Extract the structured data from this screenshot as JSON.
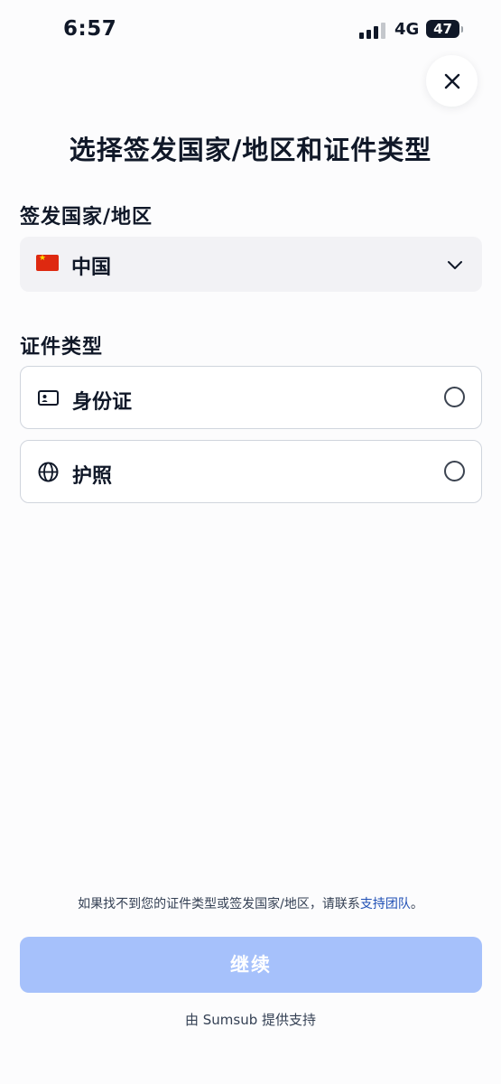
{
  "status_bar": {
    "time": "6:57",
    "network": "4G",
    "battery": "47"
  },
  "close_icon": "close-icon",
  "title": "选择签发国家/地区和证件类型",
  "country_section": {
    "label": "签发国家/地区",
    "selected_country": "中国",
    "flag_icon": "china-flag-icon",
    "dropdown_icon": "chevron-down-icon"
  },
  "doc_section": {
    "label": "证件类型",
    "options": [
      {
        "label": "身份证",
        "icon": "id-card-icon"
      },
      {
        "label": "护照",
        "icon": "globe-icon"
      }
    ]
  },
  "help": {
    "prefix": "如果找不到您的证件类型或签发国家/地区，请联系",
    "link": "支持团队",
    "suffix": "。"
  },
  "continue_label": "继续",
  "powered_by": "由 Sumsub 提供支持",
  "colors": {
    "accent_disabled": "#a6c1fb",
    "link": "#1f4fb5",
    "select_bg": "#f2f2f5"
  }
}
